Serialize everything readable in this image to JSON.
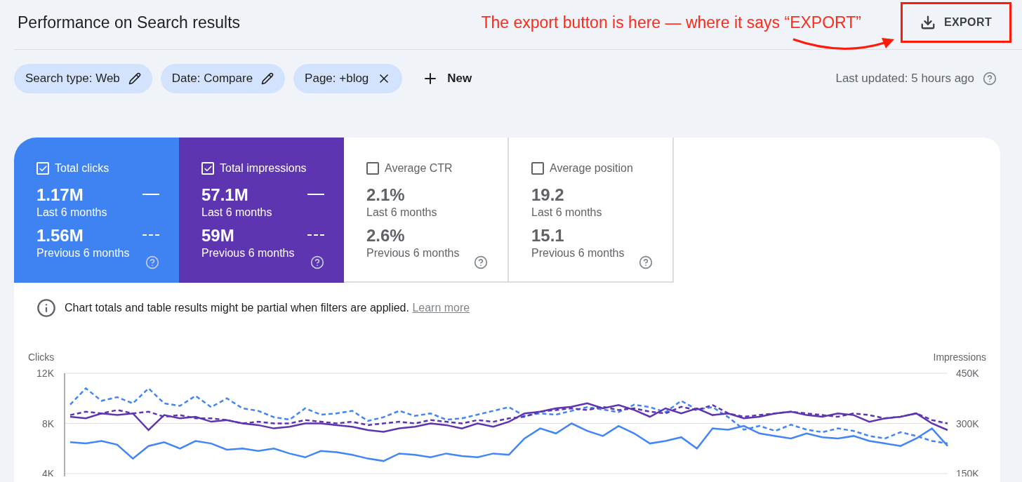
{
  "header": {
    "title": "Performance on Search results",
    "export_label": "EXPORT"
  },
  "annotation": {
    "text": "The export button is here — where it says “EXPORT”"
  },
  "filters": [
    {
      "label": "Search type: Web",
      "kind": "edit"
    },
    {
      "label": "Date: Compare",
      "kind": "edit"
    },
    {
      "label": "Page: +blog",
      "kind": "remove"
    }
  ],
  "new_button": {
    "label": "New"
  },
  "last_updated": "Last updated: 5 hours ago",
  "cards": [
    {
      "label": "Total clicks",
      "checked": true,
      "color": "#3f83f2",
      "value": "1.17M",
      "period": "Last 6 months",
      "previous_value": "1.56M",
      "previous_period": "Previous 6 months"
    },
    {
      "label": "Total impressions",
      "checked": true,
      "color": "#5e35b1",
      "value": "57.1M",
      "period": "Last 6 months",
      "previous_value": "59M",
      "previous_period": "Previous 6 months"
    },
    {
      "label": "Average CTR",
      "checked": false,
      "value": "2.1%",
      "period": "Last 6 months",
      "previous_value": "2.6%",
      "previous_period": "Previous 6 months"
    },
    {
      "label": "Average position",
      "checked": false,
      "value": "19.2",
      "period": "Last 6 months",
      "previous_value": "15.1",
      "previous_period": "Previous 6 months"
    }
  ],
  "notice": {
    "text": "Chart totals and table results might be partial when filters are applied.",
    "link": "Learn more"
  },
  "chart_data": {
    "type": "line",
    "ylabel": "Clicks",
    "ylim": [
      4000,
      12000
    ],
    "yticks": [
      {
        "value": 4000,
        "label": "4K"
      },
      {
        "value": 8000,
        "label": "8K"
      },
      {
        "value": 12000,
        "label": "12K"
      }
    ],
    "y2label": "Impressions",
    "y2lim": [
      150000,
      450000
    ],
    "y2ticks": [
      {
        "value": 150000,
        "label": "150K"
      },
      {
        "value": 300000,
        "label": "300K"
      },
      {
        "value": 450000,
        "label": "450K"
      }
    ],
    "series": [
      {
        "color": "#4285f4",
        "line_style": "solid",
        "values": [
          6500,
          6400,
          6600,
          6300,
          5200,
          6200,
          6500,
          6000,
          6600,
          6400,
          5900,
          6000,
          5800,
          6000,
          5600,
          5300,
          5800,
          5700,
          5500,
          5200,
          5000,
          5600,
          5500,
          5300,
          5600,
          5400,
          5300,
          5600,
          5500,
          6800,
          7600,
          7200,
          8000,
          7400,
          7000,
          7800,
          7200,
          6400,
          6600,
          6900,
          6000,
          7600,
          7500,
          7800,
          7200,
          7000,
          6800,
          7200,
          6900,
          6800,
          7000,
          6600,
          6400,
          6200,
          6800,
          7600,
          6200
        ]
      },
      {
        "color": "#4285f4",
        "line_style": "dashed",
        "values": [
          9500,
          10800,
          9800,
          10100,
          9600,
          10800,
          9600,
          9400,
          10200,
          9300,
          10000,
          9200,
          9000,
          8500,
          8300,
          9200,
          8700,
          8800,
          9000,
          8200,
          8500,
          9000,
          8600,
          8800,
          8300,
          8400,
          8700,
          9000,
          9300,
          8600,
          8800,
          8700,
          9000,
          9300,
          9100,
          8900,
          9500,
          9300,
          8900,
          9800,
          9100,
          9300,
          8500,
          7500,
          7800,
          7400,
          7900,
          7500,
          7300,
          7600,
          7400,
          7000,
          6800,
          7300,
          7000,
          6600,
          6400
        ]
      },
      {
        "color": "#5e35b1",
        "line_style": "solid",
        "axis": "y2",
        "values": [
          320000,
          315000,
          330000,
          325000,
          330000,
          280000,
          325000,
          315000,
          320000,
          305000,
          310000,
          300000,
          295000,
          285000,
          290000,
          300000,
          300000,
          295000,
          290000,
          280000,
          275000,
          285000,
          290000,
          300000,
          295000,
          285000,
          300000,
          290000,
          305000,
          330000,
          335000,
          345000,
          350000,
          360000,
          345000,
          355000,
          340000,
          320000,
          345000,
          330000,
          345000,
          325000,
          330000,
          315000,
          320000,
          330000,
          335000,
          325000,
          320000,
          330000,
          325000,
          305000,
          315000,
          320000,
          330000,
          300000,
          280000
        ]
      },
      {
        "color": "#5e35b1",
        "line_style": "dashed",
        "axis": "y2",
        "values": [
          325000,
          335000,
          330000,
          340000,
          330000,
          335000,
          320000,
          325000,
          315000,
          315000,
          310000,
          300000,
          305000,
          300000,
          300000,
          310000,
          305000,
          300000,
          305000,
          295000,
          300000,
          305000,
          300000,
          310000,
          305000,
          300000,
          310000,
          305000,
          315000,
          320000,
          335000,
          340000,
          345000,
          340000,
          350000,
          340000,
          345000,
          335000,
          330000,
          350000,
          340000,
          355000,
          330000,
          320000,
          325000,
          330000,
          335000,
          330000,
          325000,
          320000,
          330000,
          325000,
          315000,
          320000,
          330000,
          310000,
          300000
        ]
      }
    ]
  }
}
